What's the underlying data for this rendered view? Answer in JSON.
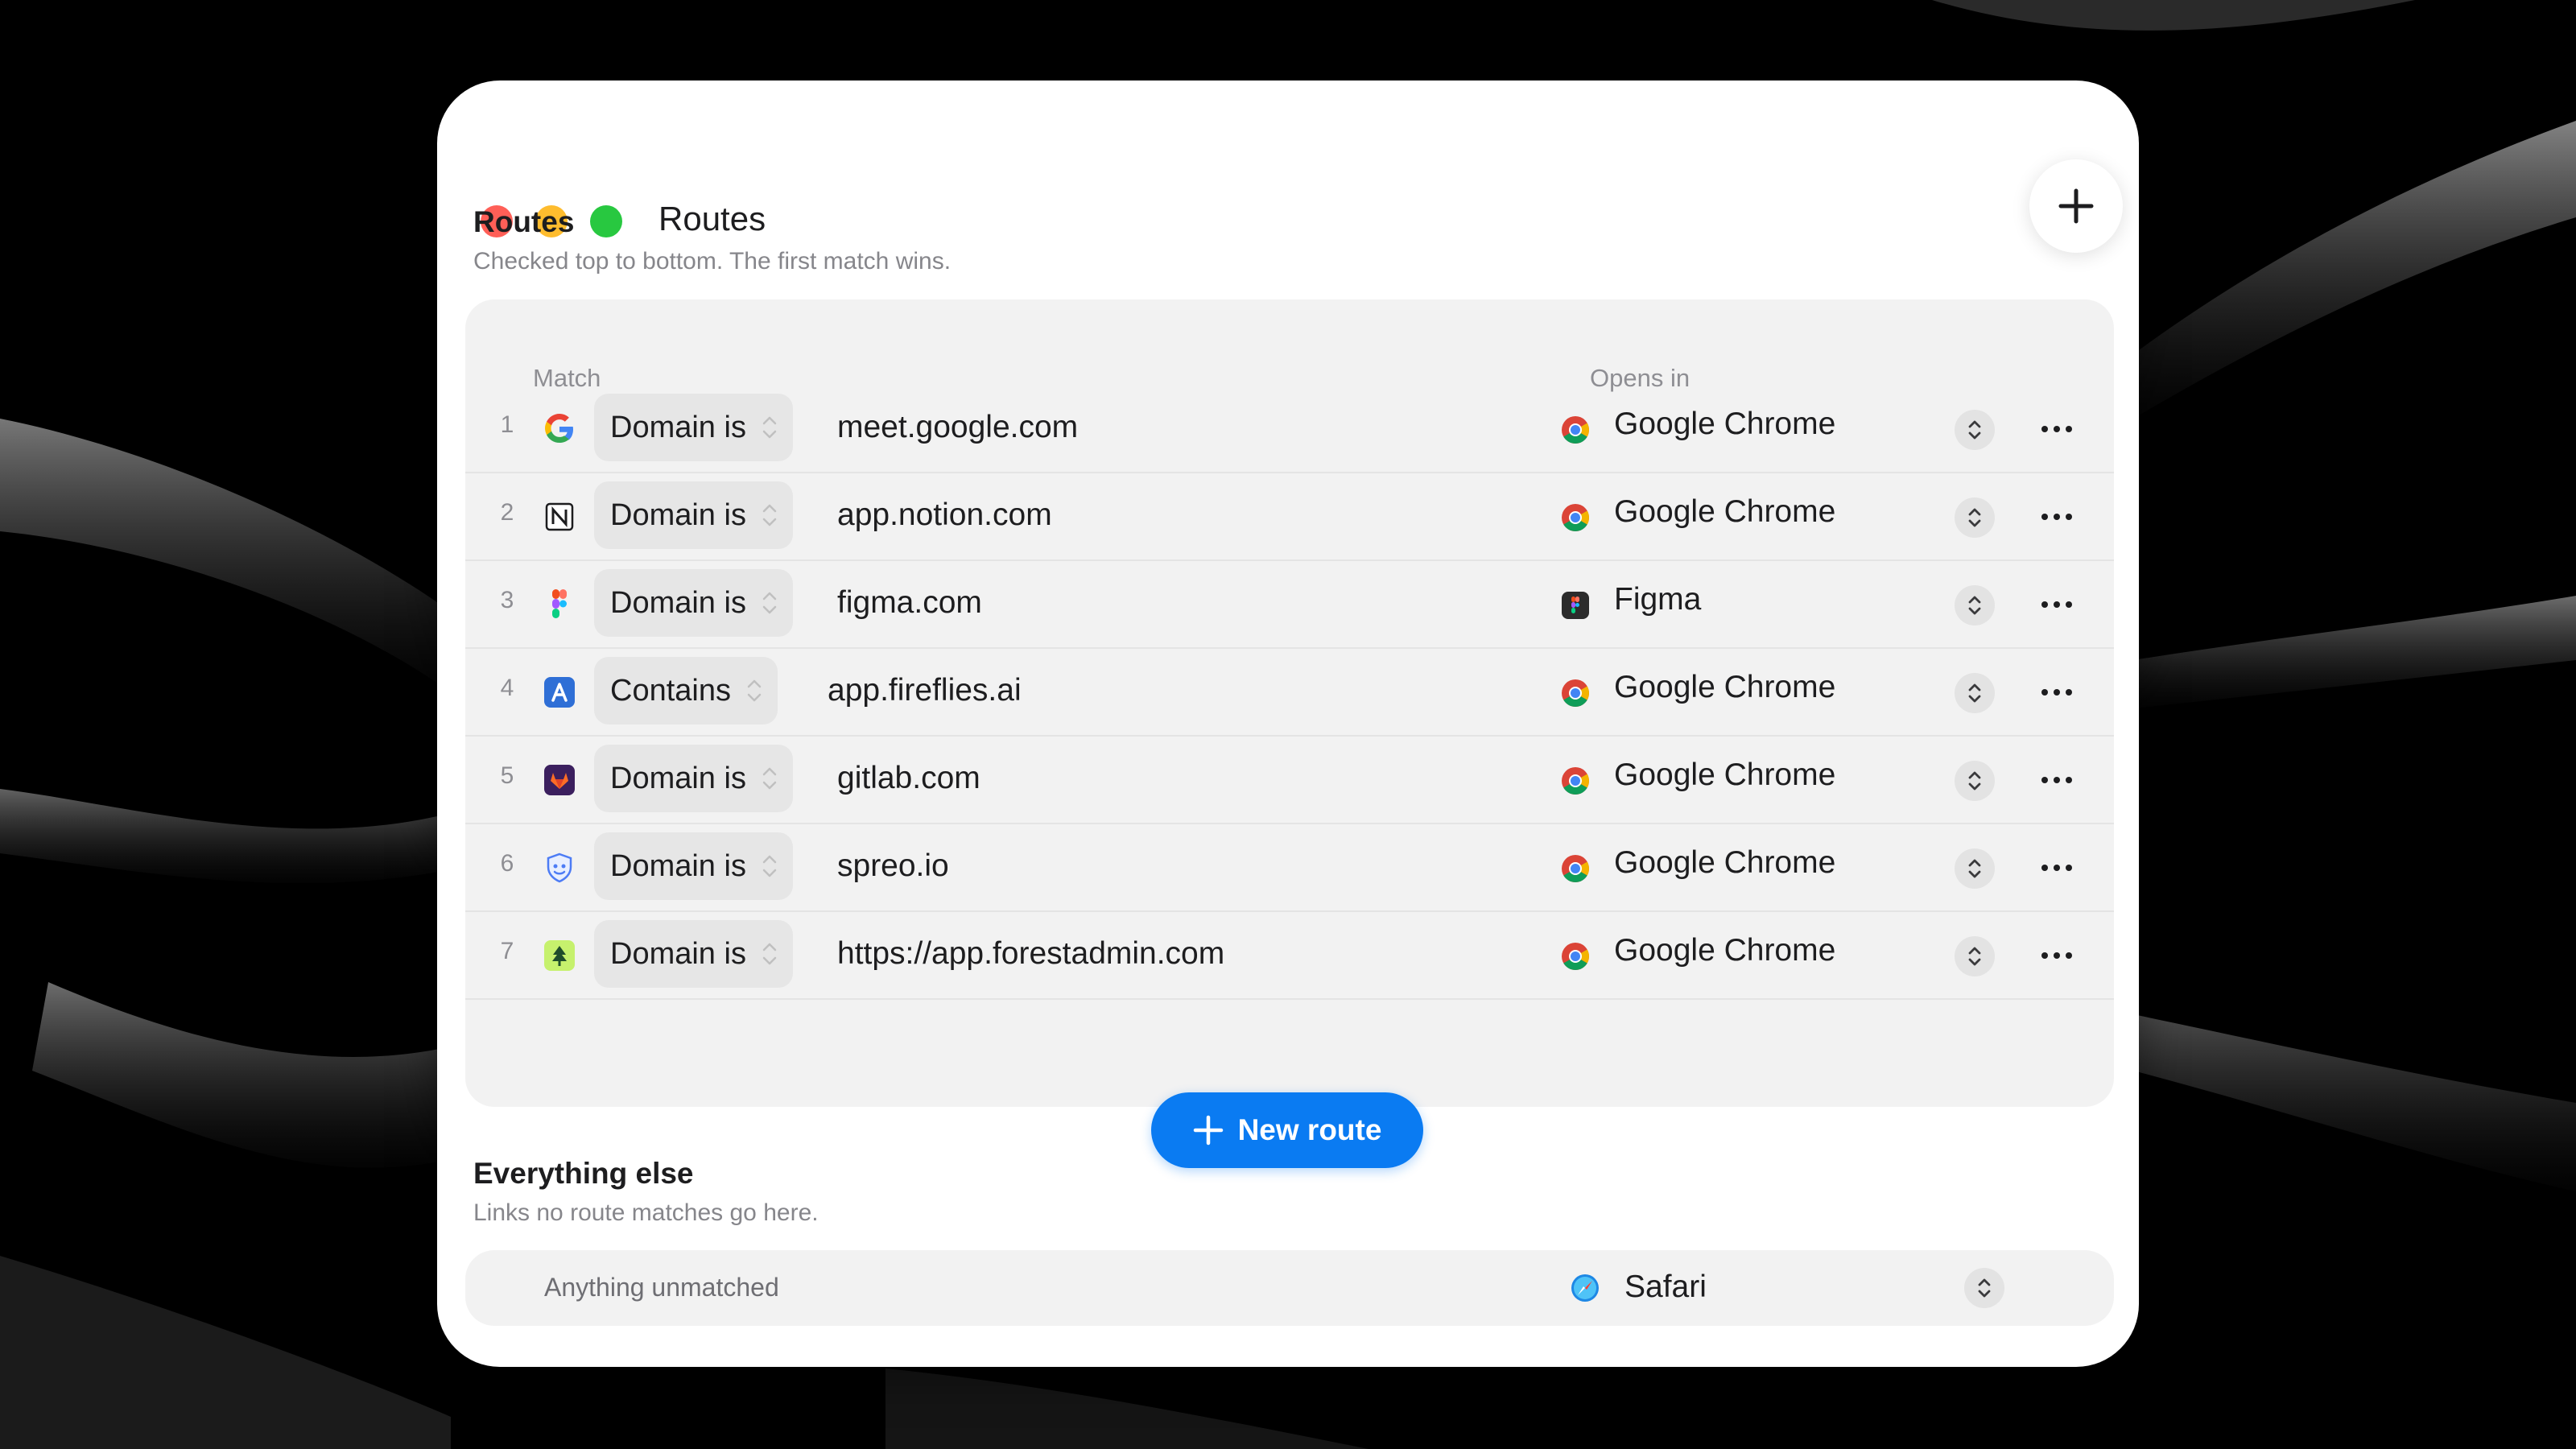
{
  "window": {
    "title": "Routes"
  },
  "routes_section": {
    "title": "Routes",
    "subtitle": "Checked top to bottom. The first match wins.",
    "col_match": "Match",
    "col_opens_in": "Opens in",
    "rows": [
      {
        "num": "1",
        "site_icon": "google-icon",
        "rule": "Domain is",
        "value": "meet.google.com",
        "app": "Google Chrome",
        "app_icon": "chrome-icon"
      },
      {
        "num": "2",
        "site_icon": "notion-icon",
        "rule": "Domain is",
        "value": "app.notion.com",
        "app": "Google Chrome",
        "app_icon": "chrome-icon"
      },
      {
        "num": "3",
        "site_icon": "figma-icon",
        "rule": "Domain is",
        "value": "figma.com",
        "app": "Figma",
        "app_icon": "figma-app-icon"
      },
      {
        "num": "4",
        "site_icon": "fireflies-icon",
        "rule": "Contains",
        "value": "app.fireflies.ai",
        "app": "Google Chrome",
        "app_icon": "chrome-icon"
      },
      {
        "num": "5",
        "site_icon": "gitlab-icon",
        "rule": "Domain is",
        "value": "gitlab.com",
        "app": "Google Chrome",
        "app_icon": "chrome-icon"
      },
      {
        "num": "6",
        "site_icon": "spreo-icon",
        "rule": "Domain is",
        "value": "spreo.io",
        "app": "Google Chrome",
        "app_icon": "chrome-icon"
      },
      {
        "num": "7",
        "site_icon": "forestadmin-icon",
        "rule": "Domain is",
        "value": "https://app.forestadmin.com",
        "app": "Google Chrome",
        "app_icon": "chrome-icon"
      }
    ],
    "new_route_label": "New route"
  },
  "fallback_section": {
    "title": "Everything else",
    "subtitle": "Links no route matches go here.",
    "label": "Anything unmatched",
    "app": "Safari",
    "app_icon": "safari-icon"
  },
  "colors": {
    "accent": "#0a7bf2",
    "close": "#ff5f57",
    "minimize": "#febc2e",
    "maximize": "#28c840"
  }
}
